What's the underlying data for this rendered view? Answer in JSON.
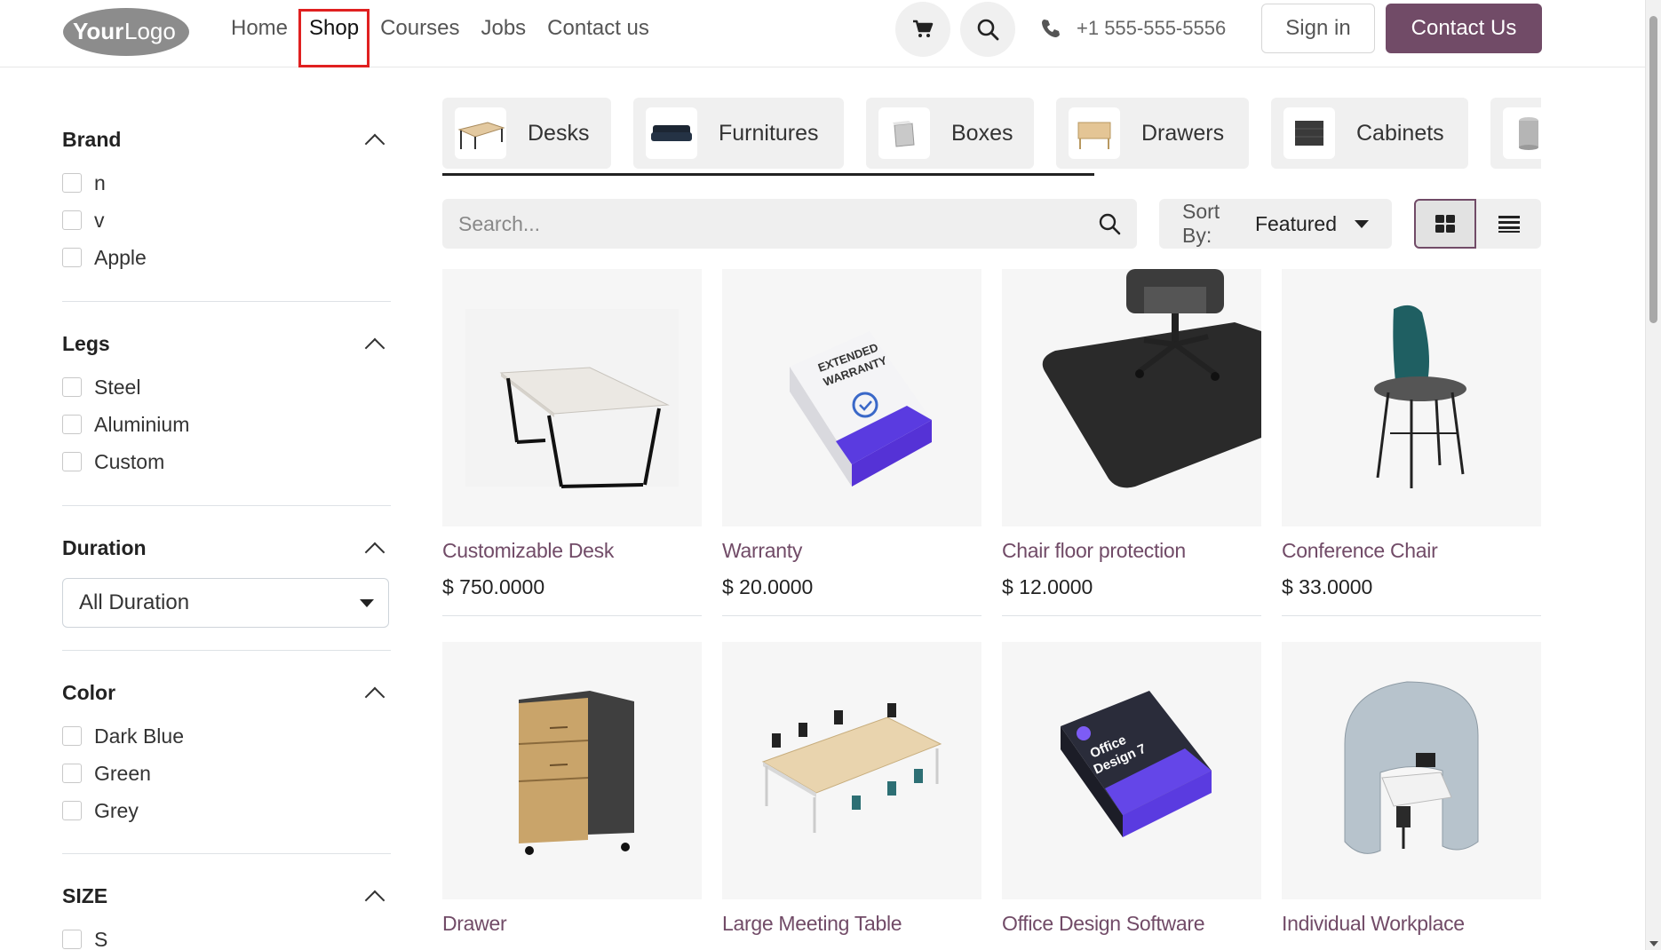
{
  "header": {
    "logo_text_bold": "Your",
    "logo_text_light": "Logo",
    "nav": [
      {
        "label": "Home",
        "active": false
      },
      {
        "label": "Shop",
        "active": true
      },
      {
        "label": "Courses",
        "active": false
      },
      {
        "label": "Jobs",
        "active": false
      },
      {
        "label": "Contact us",
        "active": false
      }
    ],
    "phone": "+1 555-555-5556",
    "sign_in": "Sign in",
    "contact_button": "Contact Us",
    "brand_color": "#714b67"
  },
  "filters": {
    "brand": {
      "title": "Brand",
      "options": [
        "n",
        "v",
        "Apple"
      ]
    },
    "legs": {
      "title": "Legs",
      "options": [
        "Steel",
        "Aluminium",
        "Custom"
      ]
    },
    "duration": {
      "title": "Duration",
      "selected": "All Duration"
    },
    "color": {
      "title": "Color",
      "options": [
        "Dark Blue",
        "Green",
        "Grey"
      ]
    },
    "size": {
      "title": "SIZE",
      "options": [
        "S"
      ]
    }
  },
  "categories": [
    {
      "label": "Desks",
      "icon": "desk-icon"
    },
    {
      "label": "Furnitures",
      "icon": "sofa-icon"
    },
    {
      "label": "Boxes",
      "icon": "box-icon"
    },
    {
      "label": "Drawers",
      "icon": "drawer-icon"
    },
    {
      "label": "Cabinets",
      "icon": "cabinet-icon"
    },
    {
      "label": "",
      "icon": "bin-icon"
    }
  ],
  "search": {
    "placeholder": "Search..."
  },
  "sort": {
    "label": "Sort By:",
    "value": "Featured"
  },
  "products": [
    {
      "name": "Customizable Desk",
      "price": "$ 750.0000",
      "image": "desk-image"
    },
    {
      "name": "Warranty",
      "price": "$ 20.0000",
      "image": "warranty-box-image"
    },
    {
      "name": "Chair floor protection",
      "price": "$ 12.0000",
      "image": "floor-mat-image"
    },
    {
      "name": "Conference Chair",
      "price": "$ 33.0000",
      "image": "chair-image"
    },
    {
      "name": "Drawer",
      "price": "",
      "image": "drawer-image"
    },
    {
      "name": "Large Meeting Table",
      "price": "",
      "image": "meeting-table-image"
    },
    {
      "name": "Office Design Software",
      "price": "",
      "image": "software-box-image"
    },
    {
      "name": "Individual Workplace",
      "price": "",
      "image": "workplace-pod-image"
    }
  ],
  "warranty_box_text": [
    "EXTENDED",
    "WARRANTY"
  ],
  "software_box_text": [
    "Office",
    "Design 7"
  ]
}
